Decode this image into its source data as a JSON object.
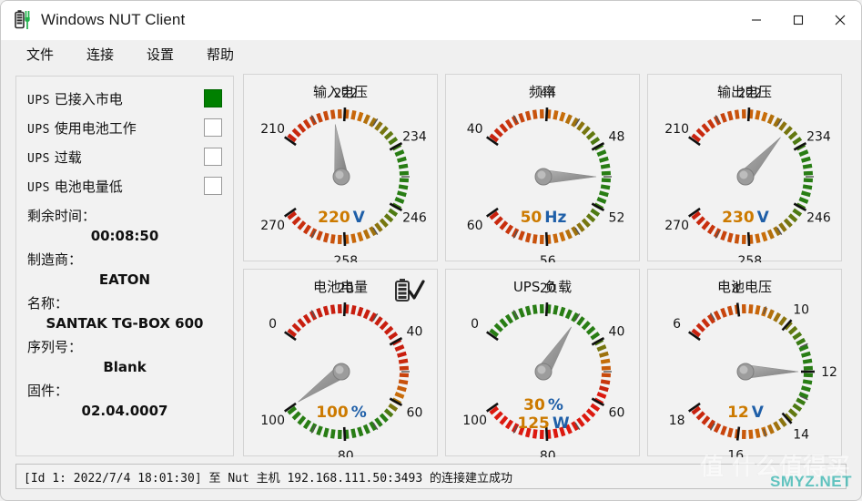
{
  "window": {
    "title": "Windows NUT Client",
    "app_icon": "battery-plug-icon",
    "controls": {
      "minimize": "minimize-icon",
      "maximize": "maximize-icon",
      "close": "close-icon"
    }
  },
  "menu": {
    "items": [
      "文件",
      "连接",
      "设置",
      "帮助"
    ]
  },
  "status_panel": {
    "indicators": [
      {
        "prefix": "UPS",
        "label": "已接入市电",
        "on": true
      },
      {
        "prefix": "UPS",
        "label": "使用电池工作",
        "on": false
      },
      {
        "prefix": "UPS",
        "label": "过载",
        "on": false
      },
      {
        "prefix": "UPS",
        "label": "电池电量低",
        "on": false
      }
    ],
    "fields": [
      {
        "label": "剩余时间：",
        "value": "00:08:50"
      },
      {
        "label": "制造商：",
        "value": "EATON"
      },
      {
        "label": "名称：",
        "value": "SANTAK TG-BOX 600"
      },
      {
        "label": "序列号：",
        "value": "Blank"
      },
      {
        "label": "固件：",
        "value": "02.04.0007"
      }
    ]
  },
  "gauges": [
    {
      "id": "input-voltage",
      "title": "输入电压",
      "min": 210,
      "max": 270,
      "ticks": [
        210,
        222,
        234,
        246,
        258,
        270
      ],
      "value": 220,
      "value_number": "220",
      "value_unit": "V",
      "value_number2": "",
      "value_unit2": "",
      "scale": "red-to-green-to-red",
      "icon": ""
    },
    {
      "id": "frequency",
      "title": "频率",
      "min": 40,
      "max": 60,
      "ticks": [
        40,
        44,
        48,
        52,
        56,
        60
      ],
      "value": 50,
      "value_number": "50",
      "value_unit": "Hz",
      "value_number2": "",
      "value_unit2": "",
      "scale": "red-to-green-to-red",
      "icon": ""
    },
    {
      "id": "output-voltage",
      "title": "输出电压",
      "min": 210,
      "max": 270,
      "ticks": [
        210,
        222,
        234,
        246,
        258,
        270
      ],
      "value": 230,
      "value_number": "230",
      "value_unit": "V",
      "value_number2": "",
      "value_unit2": "",
      "scale": "red-to-green-to-red",
      "icon": ""
    },
    {
      "id": "battery-charge",
      "title": "电池电量",
      "min": 0,
      "max": 100,
      "ticks": [
        0,
        20,
        40,
        60,
        80,
        100
      ],
      "value": 100,
      "value_number": "100",
      "value_unit": "%",
      "value_number2": "",
      "value_unit2": "",
      "scale": "red-to-green",
      "icon": "battery-ok-icon"
    },
    {
      "id": "ups-load",
      "title": "UPS 负载",
      "min": 0,
      "max": 100,
      "ticks": [
        0,
        20,
        40,
        60,
        80,
        100
      ],
      "value": 30,
      "value_number": "30",
      "value_unit": "%",
      "value_number2": "125",
      "value_unit2": "W",
      "scale": "green-to-red",
      "icon": ""
    },
    {
      "id": "battery-voltage",
      "title": "电池电压",
      "min": 6,
      "max": 18,
      "ticks": [
        6,
        8,
        10,
        12,
        14,
        16,
        18
      ],
      "value": 12,
      "value_number": "12",
      "value_unit": "V",
      "value_number2": "",
      "value_unit2": "",
      "scale": "red-to-green-to-red",
      "icon": ""
    }
  ],
  "statusbar": {
    "text": "[Id 1: 2022/7/4 18:01:30] 至 Nut 主机 192.168.111.50:3493 的连接建立成功"
  },
  "watermark": {
    "cn": "值 什么值得买",
    "en": "SMYZ.NET"
  },
  "colors": {
    "led_on": "#008000",
    "value_number": "#cc7a00",
    "value_unit": "#1f5fa8",
    "panel_bg": "#f2f2f2",
    "panel_border": "#d4d4d4",
    "window_bg": "#f0f0f0"
  }
}
